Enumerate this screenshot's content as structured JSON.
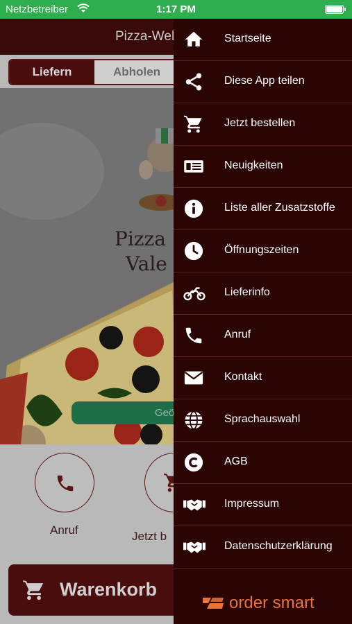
{
  "status_bar": {
    "carrier": "Netzbetreiber",
    "time": "1:17 PM"
  },
  "app": {
    "header_title": "Pizza-Wel",
    "order_mode": {
      "tabs": [
        "Liefern",
        "Abholen"
      ],
      "selected": "Liefern"
    },
    "hero_logo_lines": [
      "Pizza",
      "Vale"
    ],
    "status_button": "Geö",
    "quick_actions": [
      {
        "label": "Anruf",
        "icon": "phone-icon"
      },
      {
        "label": "Jetzt b",
        "icon": "cart-icon"
      }
    ],
    "cart_label": "Warenkorb"
  },
  "drawer": {
    "items": [
      {
        "label": "Startseite",
        "icon": "home-icon"
      },
      {
        "label": "Diese App teilen",
        "icon": "share-icon"
      },
      {
        "label": "Jetzt bestellen",
        "icon": "cart-icon"
      },
      {
        "label": "Neuigkeiten",
        "icon": "news-icon"
      },
      {
        "label": "Liste aller Zusatzstoffe",
        "icon": "info-icon"
      },
      {
        "label": "Öffnungszeiten",
        "icon": "clock-icon"
      },
      {
        "label": "Lieferinfo",
        "icon": "motorbike-icon"
      },
      {
        "label": "Anruf",
        "icon": "phone-icon"
      },
      {
        "label": "Kontakt",
        "icon": "envelope-icon"
      },
      {
        "label": "Sprachauswahl",
        "icon": "globe-icon"
      },
      {
        "label": "AGB",
        "icon": "copyright-icon"
      },
      {
        "label": "Impressum",
        "icon": "handshake-icon"
      },
      {
        "label": "Datenschutzerklärung",
        "icon": "handshake-icon"
      }
    ],
    "brand": "order smart"
  },
  "colors": {
    "status_bar": "#2eae4f",
    "drawer_bg": "#2b0404",
    "brand_orange": "#e8743b",
    "accent_maroon": "#4a0d0d"
  }
}
